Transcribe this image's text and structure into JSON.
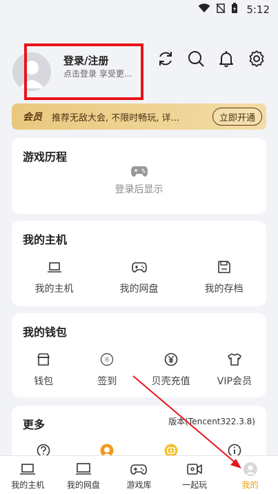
{
  "status": {
    "time": "5:12"
  },
  "profile": {
    "title": "登录/注册",
    "subtitle": "点击登录 享受更..."
  },
  "vip": {
    "tag": "会员",
    "text": "推荐无敌大会, 不限时畅玩, 详...",
    "button": "立即开通"
  },
  "history": {
    "title": "游戏历程",
    "hint": "登录后显示"
  },
  "host": {
    "title": "我的主机",
    "items": [
      {
        "label": "我的主机"
      },
      {
        "label": "我的网盘"
      },
      {
        "label": "我的存档"
      }
    ]
  },
  "wallet": {
    "title": "我的钱包",
    "items": [
      {
        "label": "钱包"
      },
      {
        "label": "签到"
      },
      {
        "label": "贝壳充值"
      },
      {
        "label": "VIP会员"
      }
    ]
  },
  "more": {
    "title": "更多",
    "version": "版本(Tencent322.3.8)"
  },
  "tabs": [
    {
      "label": "我的主机"
    },
    {
      "label": "我的网盘"
    },
    {
      "label": "游戏库"
    },
    {
      "label": "一起玩"
    },
    {
      "label": "我的"
    }
  ],
  "colors": {
    "accent": "#e8a317",
    "highlight_box": "#e8141b",
    "annotation_arrow": "#e8141b"
  }
}
